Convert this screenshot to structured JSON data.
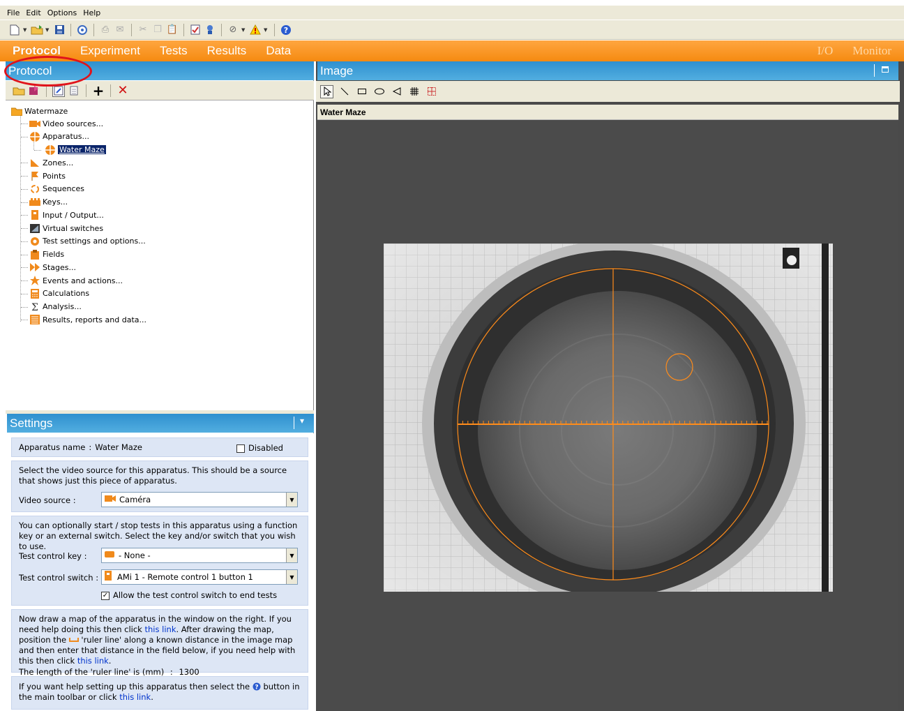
{
  "menu": [
    "File",
    "Edit",
    "Options",
    "Help"
  ],
  "tabs": {
    "left": [
      "Protocol",
      "Experiment",
      "Tests",
      "Results",
      "Data"
    ],
    "active": "Protocol",
    "right": [
      "I/O",
      "Monitor"
    ]
  },
  "protocol_panel": {
    "title": "Protocol"
  },
  "tree": {
    "root": "Watermaze",
    "items": [
      {
        "label": "Video sources...",
        "icon": "camera-icon"
      },
      {
        "label": "Apparatus...",
        "icon": "apparatus-icon"
      },
      {
        "label": "Water Maze",
        "icon": "apparatus-icon",
        "selected": true
      },
      {
        "label": "Zones...",
        "icon": "zones-icon"
      },
      {
        "label": "Points",
        "icon": "flag-icon"
      },
      {
        "label": "Sequences",
        "icon": "sequence-icon"
      },
      {
        "label": "Keys...",
        "icon": "keys-icon"
      },
      {
        "label": "Input / Output...",
        "icon": "io-icon"
      },
      {
        "label": "Virtual switches",
        "icon": "switch-icon"
      },
      {
        "label": "Test settings and options...",
        "icon": "gear-icon"
      },
      {
        "label": "Fields",
        "icon": "clipboard-icon"
      },
      {
        "label": "Stages...",
        "icon": "stages-icon"
      },
      {
        "label": "Events and actions...",
        "icon": "event-icon"
      },
      {
        "label": "Calculations",
        "icon": "calculator-icon"
      },
      {
        "label": "Analysis...",
        "icon": "sigma-icon"
      },
      {
        "label": "Results, reports and data...",
        "icon": "report-icon"
      }
    ]
  },
  "settings": {
    "title": "Settings",
    "apparatus_name_label": "Apparatus name",
    "apparatus_name_sep": ":",
    "apparatus_name_value": "Water Maze",
    "disabled_label": "Disabled",
    "video_text": "Select the video source for this apparatus. This should be a source that shows just this piece of apparatus.",
    "video_source_label": "Video source :",
    "video_source_value": "Caméra",
    "control_text": "You can optionally start / stop tests in this apparatus using a function key or an external switch. Select the key and/or switch that you wish to use.",
    "test_key_label": "Test control key :",
    "test_key_value": "- None -",
    "test_switch_label": "Test control switch :",
    "test_switch_value": "AMi 1 - Remote control 1 button 1",
    "allow_end_label": "Allow the test control switch to end tests",
    "map_text_1": "Now draw a map of the apparatus in the window on the right. If you need help doing this then click",
    "map_link_1": "this link",
    "map_text_2": ". After drawing the map, position the",
    "map_text_3": "'ruler line' along a known distance in the image map and then enter that distance in the field below, if you need help with this then click",
    "map_link_2": "this link",
    "map_text_4": ".",
    "ruler_label": "The length of the 'ruler line' is (mm)",
    "ruler_sep": ":",
    "ruler_value": "1300",
    "help_text_1": "If you want help setting up this apparatus then select the",
    "help_text_2": "button in the main toolbar or click",
    "help_link": "this link",
    "help_text_3": "."
  },
  "image_panel": {
    "title": "Image",
    "caption": "Water Maze"
  },
  "colors": {
    "orange_tab": "#f58a10",
    "panel_blue": "#3a9bd6",
    "overlay": "#ff8c1a",
    "annotation": "#e0131b"
  }
}
